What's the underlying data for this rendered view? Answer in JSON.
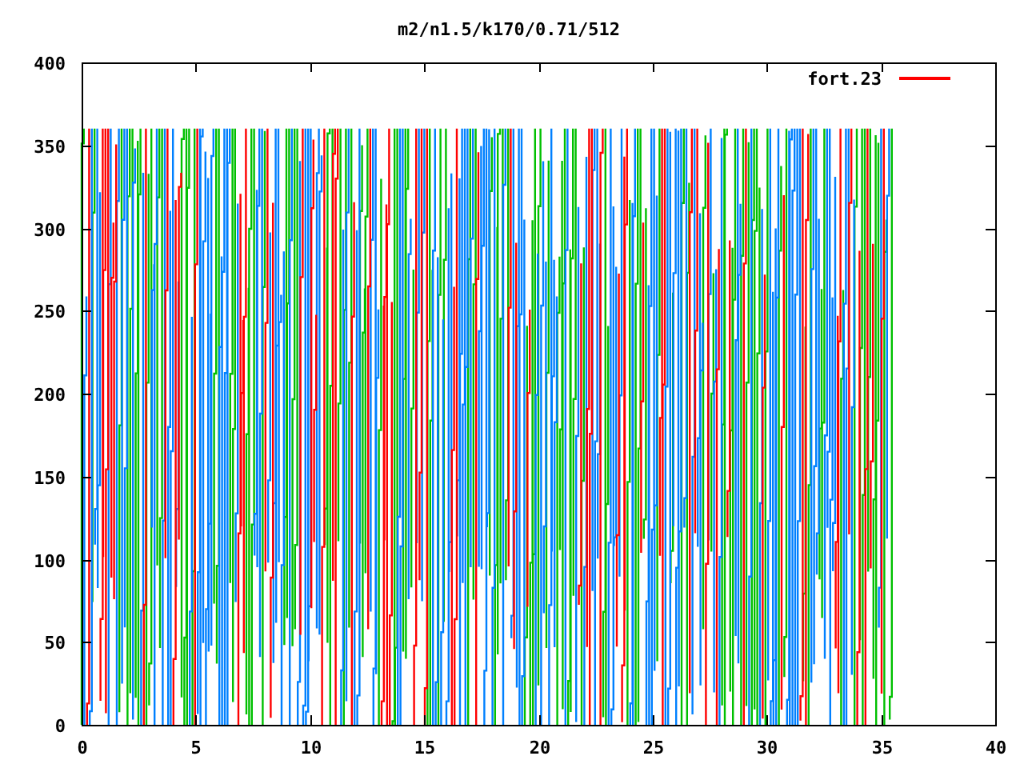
{
  "title": "m2/n1.5/k170/0.71/512",
  "legend": [
    {
      "label": "fort.23",
      "color": "#ff0000"
    }
  ],
  "x_ticks": [
    "0",
    "5",
    "10",
    "15",
    "20",
    "25",
    "30",
    "35",
    "40"
  ],
  "y_ticks": [
    "400",
    "350",
    "300",
    "250",
    "200",
    "150",
    "100",
    "50",
    "0"
  ]
}
